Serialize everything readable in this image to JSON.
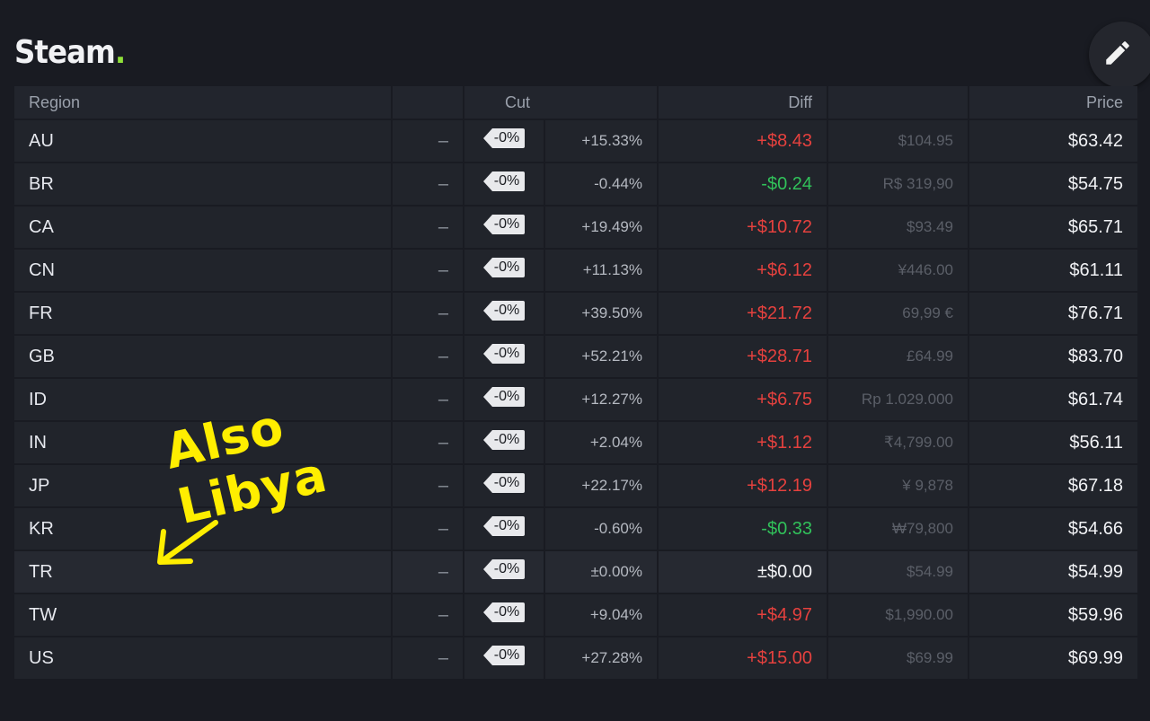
{
  "brand": {
    "name": "Steam",
    "dot": ".",
    "accent": "#8fe03a"
  },
  "header": {
    "region": "Region",
    "cut": "Cut",
    "diff": "Diff",
    "price": "Price"
  },
  "colors": {
    "positive": "#e5413e",
    "negative": "#31c15a",
    "background": "#191b22"
  },
  "annotation": {
    "text": "Also Libya",
    "color": "#ffee00"
  },
  "icons": {
    "edit": "pencil-icon",
    "cut_tag": "tag-icon",
    "arrow": "arrow-down-left-icon"
  },
  "rows": [
    {
      "region": "AU",
      "dash": "–",
      "cut": "-0%",
      "pct": "+15.33%",
      "diff": "+$8.43",
      "original": "$104.95",
      "price": "$63.42"
    },
    {
      "region": "BR",
      "dash": "–",
      "cut": "-0%",
      "pct": "-0.44%",
      "diff": "-$0.24",
      "original": "R$ 319,90",
      "price": "$54.75"
    },
    {
      "region": "CA",
      "dash": "–",
      "cut": "-0%",
      "pct": "+19.49%",
      "diff": "+$10.72",
      "original": "$93.49",
      "price": "$65.71"
    },
    {
      "region": "CN",
      "dash": "–",
      "cut": "-0%",
      "pct": "+11.13%",
      "diff": "+$6.12",
      "original": "¥446.00",
      "price": "$61.11"
    },
    {
      "region": "FR",
      "dash": "–",
      "cut": "-0%",
      "pct": "+39.50%",
      "diff": "+$21.72",
      "original": "69,99 €",
      "price": "$76.71"
    },
    {
      "region": "GB",
      "dash": "–",
      "cut": "-0%",
      "pct": "+52.21%",
      "diff": "+$28.71",
      "original": "£64.99",
      "price": "$83.70"
    },
    {
      "region": "ID",
      "dash": "–",
      "cut": "-0%",
      "pct": "+12.27%",
      "diff": "+$6.75",
      "original": "Rp 1.029.000",
      "price": "$61.74"
    },
    {
      "region": "IN",
      "dash": "–",
      "cut": "-0%",
      "pct": "+2.04%",
      "diff": "+$1.12",
      "original": "₹4,799.00",
      "price": "$56.11"
    },
    {
      "region": "JP",
      "dash": "–",
      "cut": "-0%",
      "pct": "+22.17%",
      "diff": "+$12.19",
      "original": "¥ 9,878",
      "price": "$67.18"
    },
    {
      "region": "KR",
      "dash": "–",
      "cut": "-0%",
      "pct": "-0.60%",
      "diff": "-$0.33",
      "original": "₩79,800",
      "price": "$54.66"
    },
    {
      "region": "TR",
      "dash": "–",
      "cut": "-0%",
      "pct": "±0.00%",
      "diff": "±$0.00",
      "original": "$54.99",
      "price": "$54.99"
    },
    {
      "region": "TW",
      "dash": "–",
      "cut": "-0%",
      "pct": "+9.04%",
      "diff": "+$4.97",
      "original": "$1,990.00",
      "price": "$59.96"
    },
    {
      "region": "US",
      "dash": "–",
      "cut": "-0%",
      "pct": "+27.28%",
      "diff": "+$15.00",
      "original": "$69.99",
      "price": "$69.99"
    }
  ]
}
